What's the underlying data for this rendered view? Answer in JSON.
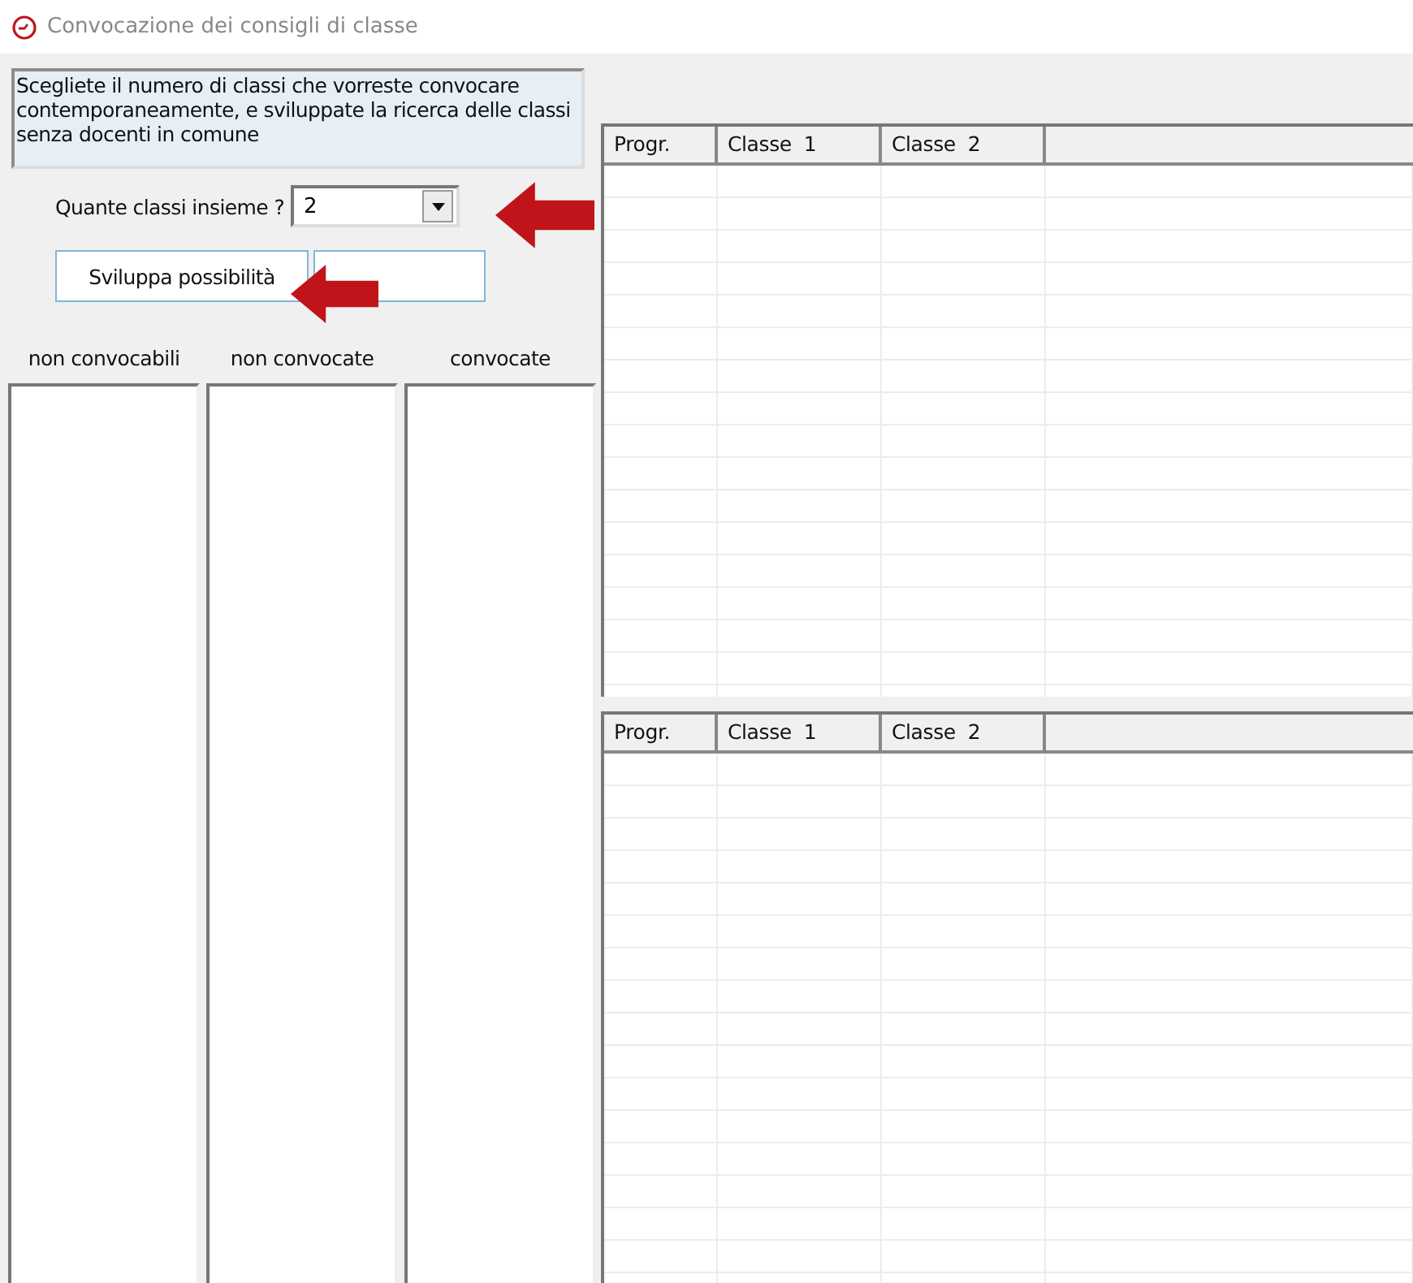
{
  "window": {
    "title": "Convocazione dei consigli di classe"
  },
  "instructions": "Scegliete il numero di classi che vorreste convocare contemporaneamente, e sviluppate la ricerca delle classi senza docenti in comune",
  "class_count": {
    "label": "Quante classi insieme ?",
    "value": "2"
  },
  "develop_button": {
    "label": "Sviluppa possibilità"
  },
  "lists": [
    {
      "title": "non convocabili"
    },
    {
      "title": "non convocate"
    },
    {
      "title": "convocate"
    }
  ],
  "grids": [
    {
      "columns": [
        "Progr.",
        "Classe  1",
        "Classe  2"
      ]
    },
    {
      "columns": [
        "Progr.",
        "Classe  1",
        "Classe  2"
      ]
    }
  ]
}
